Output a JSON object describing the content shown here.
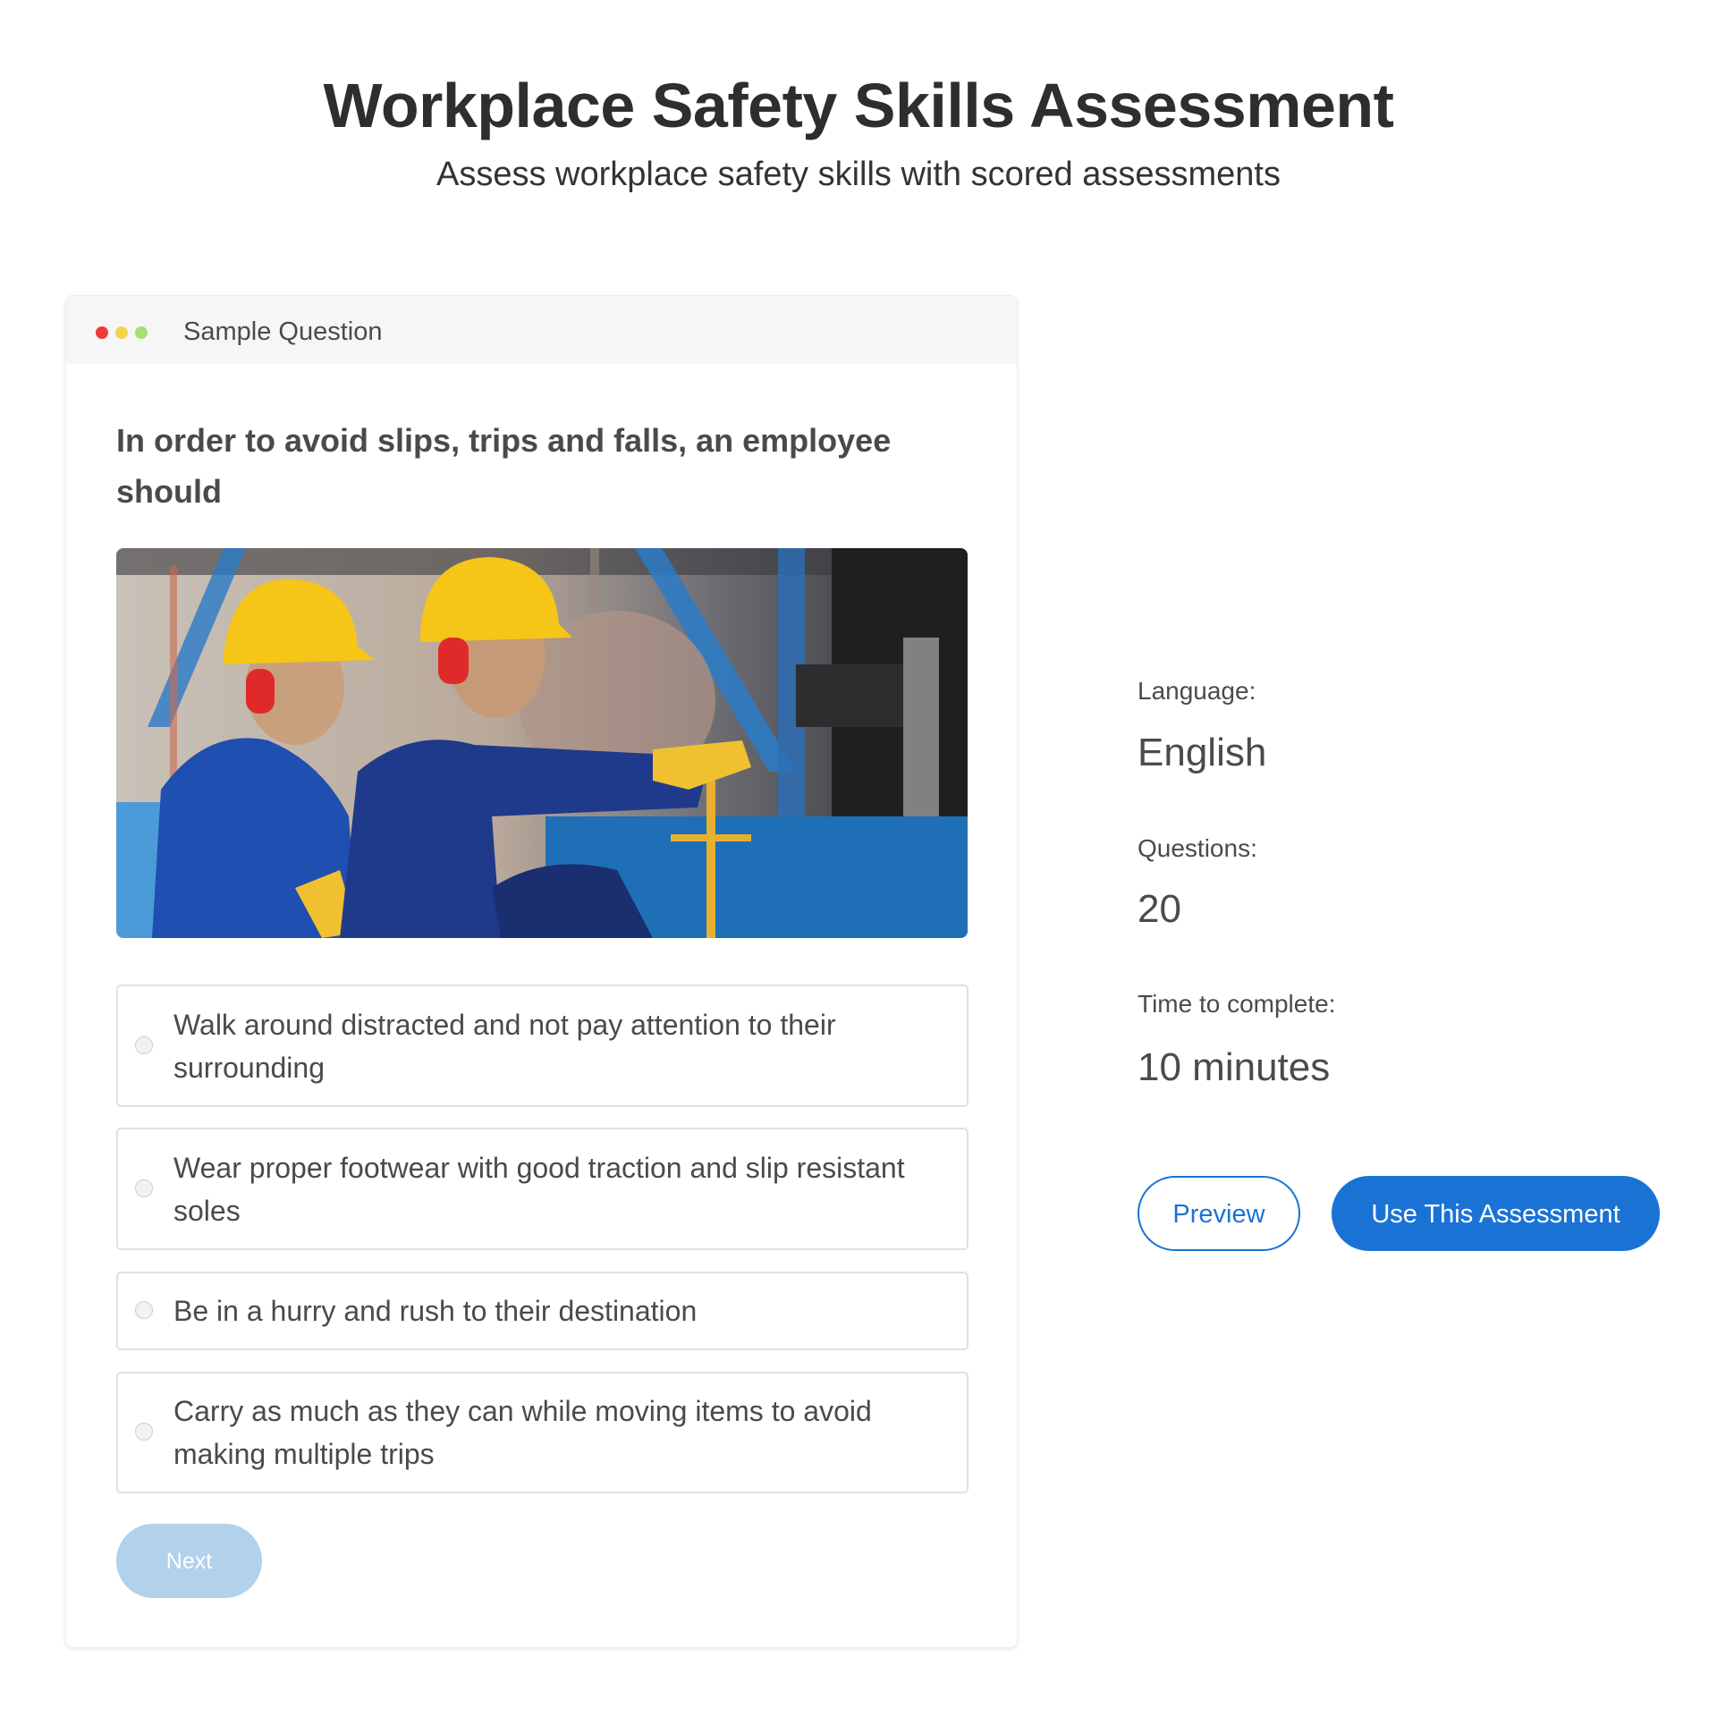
{
  "header": {
    "title": "Workplace Safety Skills Assessment",
    "subtitle": "Assess workplace safety skills with scored assessments"
  },
  "sample_card": {
    "window_dots": [
      "red",
      "yellow",
      "green"
    ],
    "title": "Sample Question",
    "question": "In order to avoid slips, trips and falls, an employee should",
    "image": {
      "description": "Two workers in blue coveralls, yellow hard hats, red ear protection and yellow gloves in an industrial workshop, one pointing at machinery",
      "colors": {
        "hardhat": "#f5c518",
        "coverall": "#1f3a8a",
        "background_blue": "#1e6fb5"
      }
    },
    "options": [
      {
        "label": "Walk around distracted and not pay attention to their surrounding",
        "selected": false
      },
      {
        "label": "Wear proper footwear with good traction and slip resistant soles",
        "selected": false
      },
      {
        "label": "Be in a hurry and rush to their destination",
        "selected": false
      },
      {
        "label": "Carry as much as they can while moving items to avoid making multiple trips",
        "selected": false
      }
    ],
    "next_label": "Next",
    "next_disabled": true
  },
  "info": {
    "language_label": "Language:",
    "language_value": "English",
    "questions_label": "Questions:",
    "questions_value": "20",
    "time_label": "Time to complete:",
    "time_value": "10 minutes"
  },
  "actions": {
    "preview_label": "Preview",
    "use_label": "Use This Assessment"
  },
  "colors": {
    "primary": "#1a73d4",
    "next_disabled": "#b2d1ea",
    "dot_red": "#ee3a3a",
    "dot_yellow": "#f5d547",
    "dot_green": "#a8dd74"
  }
}
